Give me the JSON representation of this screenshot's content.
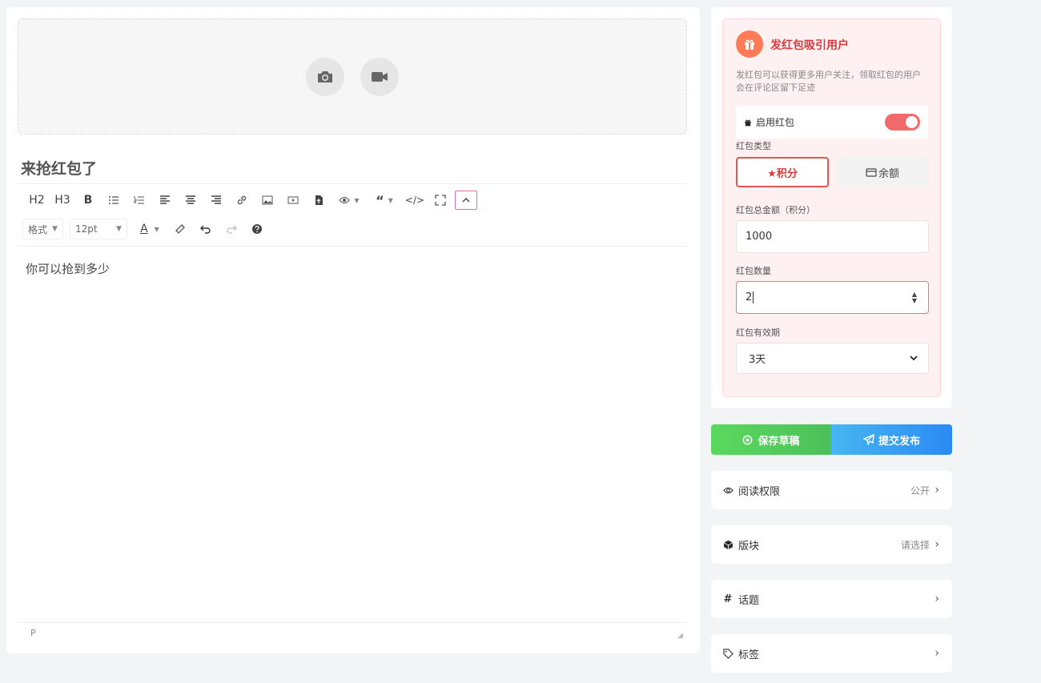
{
  "editor": {
    "title": "来抢红包了",
    "content": "你可以抢到多少",
    "status_path": "P",
    "toolbar": {
      "h2": "H2",
      "h3": "H3",
      "bold": "B",
      "format_select": "格式",
      "size_select": "12pt",
      "font_color": "A"
    }
  },
  "redpacket": {
    "title": "发红包吸引用户",
    "description": "发红包可以获得更多用户关注，领取红包的用户会在评论区留下足迹",
    "enable_label": "启用红包",
    "enabled": true,
    "type_label": "红包类型",
    "type_options": [
      "★积分",
      "余额"
    ],
    "selected_type": "★积分",
    "total_label": "红包总金额（积分）",
    "total_value": "1000",
    "count_label": "红包数量",
    "count_value": "2",
    "validity_label": "红包有效期",
    "validity_value": "3天"
  },
  "actions": {
    "save_label": "保存草稿",
    "publish_label": "提交发布"
  },
  "options": {
    "read_permission": {
      "label": "阅读权限",
      "value": "公开"
    },
    "section": {
      "label": "版块",
      "value": "请选择"
    },
    "topic": {
      "label": "话题"
    },
    "tags": {
      "label": "标签"
    }
  },
  "colors": {
    "accent_red": "#e25555",
    "save_green": "#4cc05a",
    "publish_blue": "#2b8af5",
    "redpacket_bg": "#fff1f1"
  }
}
